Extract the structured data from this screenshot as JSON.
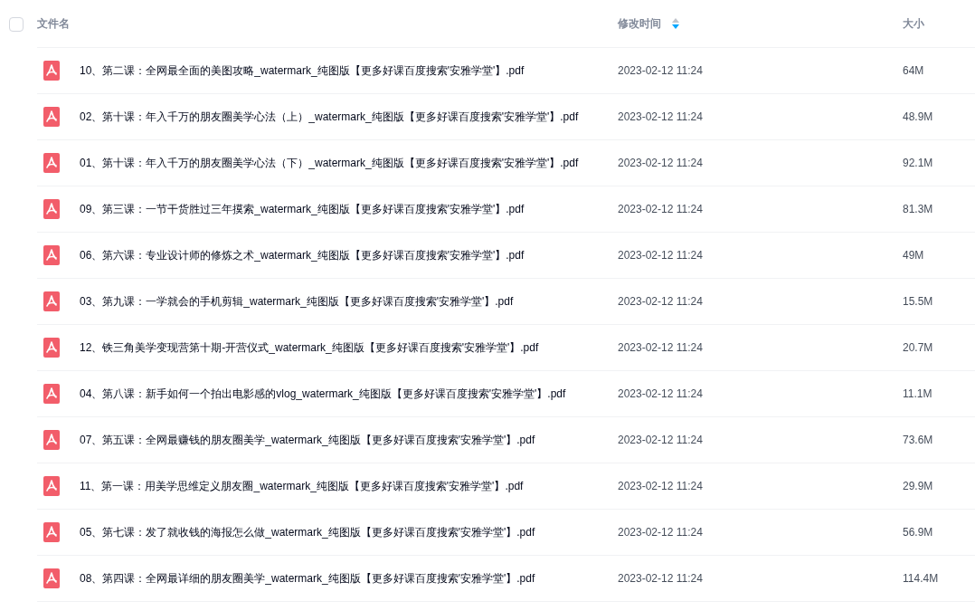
{
  "table": {
    "select_all": {
      "checked": false
    },
    "columns": [
      {
        "label": "文件名",
        "sorted": false
      },
      {
        "label": "修改时间",
        "sorted": true
      },
      {
        "label": "大小",
        "sorted": false
      }
    ],
    "rows": [
      {
        "kind": "pdf",
        "name": "10、第二课：全网最全面的美图攻略_watermark_纯图版【更多好课百度搜索'安雅学堂'】.pdf",
        "modified": "2023-02-12 11:24",
        "size": "64M"
      },
      {
        "kind": "pdf",
        "name": "02、第十课：年入千万的朋友圈美学心法（上）_watermark_纯图版【更多好课百度搜索'安雅学堂'】.pdf",
        "modified": "2023-02-12 11:24",
        "size": "48.9M"
      },
      {
        "kind": "pdf",
        "name": "01、第十课：年入千万的朋友圈美学心法（下）_watermark_纯图版【更多好课百度搜索'安雅学堂'】.pdf",
        "modified": "2023-02-12 11:24",
        "size": "92.1M"
      },
      {
        "kind": "pdf",
        "name": "09、第三课：一节干货胜过三年摸索_watermark_纯图版【更多好课百度搜索'安雅学堂'】.pdf",
        "modified": "2023-02-12 11:24",
        "size": "81.3M"
      },
      {
        "kind": "pdf",
        "name": "06、第六课：专业设计师的修炼之术_watermark_纯图版【更多好课百度搜索'安雅学堂'】.pdf",
        "modified": "2023-02-12 11:24",
        "size": "49M"
      },
      {
        "kind": "pdf",
        "name": "03、第九课：一学就会的手机剪辑_watermark_纯图版【更多好课百度搜索'安雅学堂'】.pdf",
        "modified": "2023-02-12 11:24",
        "size": "15.5M"
      },
      {
        "kind": "pdf",
        "name": "12、铁三角美学变现营第十期-开营仪式_watermark_纯图版【更多好课百度搜索'安雅学堂'】.pdf",
        "modified": "2023-02-12 11:24",
        "size": "20.7M"
      },
      {
        "kind": "pdf",
        "name": "04、第八课：新手如何一个拍出电影感的vlog_watermark_纯图版【更多好课百度搜索'安雅学堂'】.pdf",
        "modified": "2023-02-12 11:24",
        "size": "11.1M"
      },
      {
        "kind": "pdf",
        "name": "07、第五课：全网最赚钱的朋友圈美学_watermark_纯图版【更多好课百度搜索'安雅学堂'】.pdf",
        "modified": "2023-02-12 11:24",
        "size": "73.6M"
      },
      {
        "kind": "pdf",
        "name": "11、第一课：用美学思维定义朋友圈_watermark_纯图版【更多好课百度搜索'安雅学堂'】.pdf",
        "modified": "2023-02-12 11:24",
        "size": "29.9M"
      },
      {
        "kind": "pdf",
        "name": "05、第七课：发了就收钱的海报怎么做_watermark_纯图版【更多好课百度搜索'安雅学堂'】.pdf",
        "modified": "2023-02-12 11:24",
        "size": "56.9M"
      },
      {
        "kind": "pdf",
        "name": "08、第四课：全网最详细的朋友圈美学_watermark_纯图版【更多好课百度搜索'安雅学堂'】.pdf",
        "modified": "2023-02-12 11:24",
        "size": "114.4M"
      }
    ]
  }
}
